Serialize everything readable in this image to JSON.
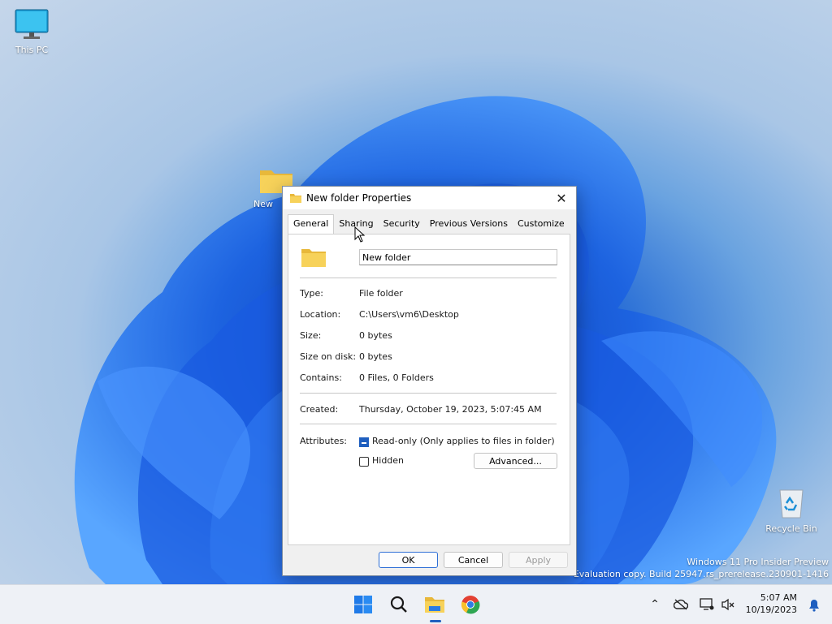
{
  "desktop": {
    "icons": [
      {
        "label": "This PC"
      },
      {
        "label": "New"
      },
      {
        "label": "Recycle Bin"
      }
    ],
    "watermark": {
      "line1": "Windows 11 Pro Insider Preview",
      "line2": "Evaluation copy. Build 25947.rs_prerelease.230901-1416"
    }
  },
  "dialog": {
    "title": "New folder Properties",
    "close_icon": "close-icon",
    "tabs": [
      {
        "label": "General",
        "active": true
      },
      {
        "label": "Sharing"
      },
      {
        "label": "Security"
      },
      {
        "label": "Previous Versions"
      },
      {
        "label": "Customize"
      }
    ],
    "name_value": "New folder",
    "rows": [
      {
        "label": "Type:",
        "value": "File folder"
      },
      {
        "label": "Location:",
        "value": "C:\\Users\\vm6\\Desktop"
      },
      {
        "label": "Size:",
        "value": "0 bytes"
      },
      {
        "label": "Size on disk:",
        "value": "0 bytes"
      },
      {
        "label": "Contains:",
        "value": "0 Files, 0 Folders"
      }
    ],
    "created": {
      "label": "Created:",
      "value": "Thursday, October 19, 2023, 5:07:45 AM"
    },
    "attributes": {
      "label": "Attributes:",
      "readonly_label": "Read-only (Only applies to files in folder)",
      "readonly_state": "indeterminate",
      "hidden_label": "Hidden",
      "hidden_checked": false,
      "advanced_label": "Advanced..."
    },
    "buttons": {
      "ok": "OK",
      "cancel": "Cancel",
      "apply": "Apply"
    }
  },
  "taskbar": {
    "apps": [
      "windows-start-icon",
      "search-icon",
      "file-explorer-icon",
      "chrome-icon"
    ],
    "tray": [
      "chevron-up-icon",
      "onedrive-offline-icon",
      "network-icon",
      "volume-muted-icon",
      "notification-bell-icon"
    ],
    "clock": {
      "time": "5:07 AM",
      "date": "10/19/2023"
    }
  },
  "colors": {
    "accent": "#1f5fbf",
    "taskbar_bg": "#eef1f6",
    "dialog_bg": "#f0f0f0"
  }
}
